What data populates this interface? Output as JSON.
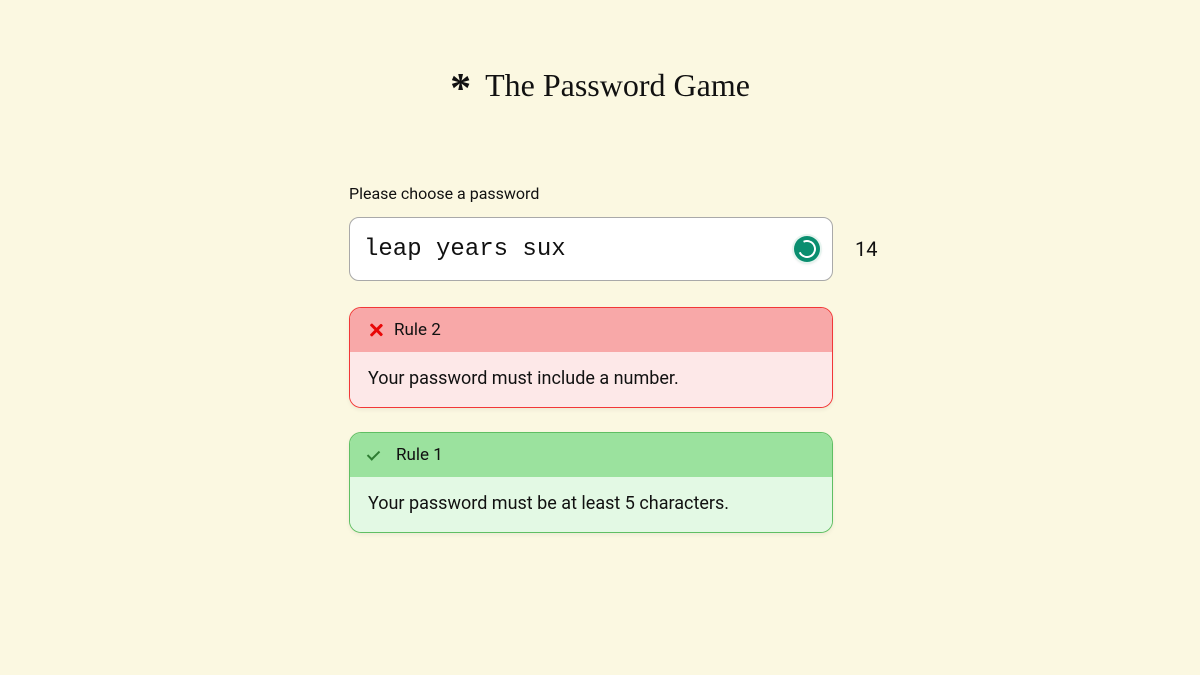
{
  "title_asterisk": "*",
  "title": "The Password Game",
  "prompt": "Please choose a password",
  "password_value": "leap years sux",
  "char_count": "14",
  "rules": [
    {
      "status": "fail",
      "label": "Rule 2",
      "text": "Your password must include a number."
    },
    {
      "status": "pass",
      "label": "Rule 1",
      "text": "Your password must be at least 5 characters."
    }
  ]
}
